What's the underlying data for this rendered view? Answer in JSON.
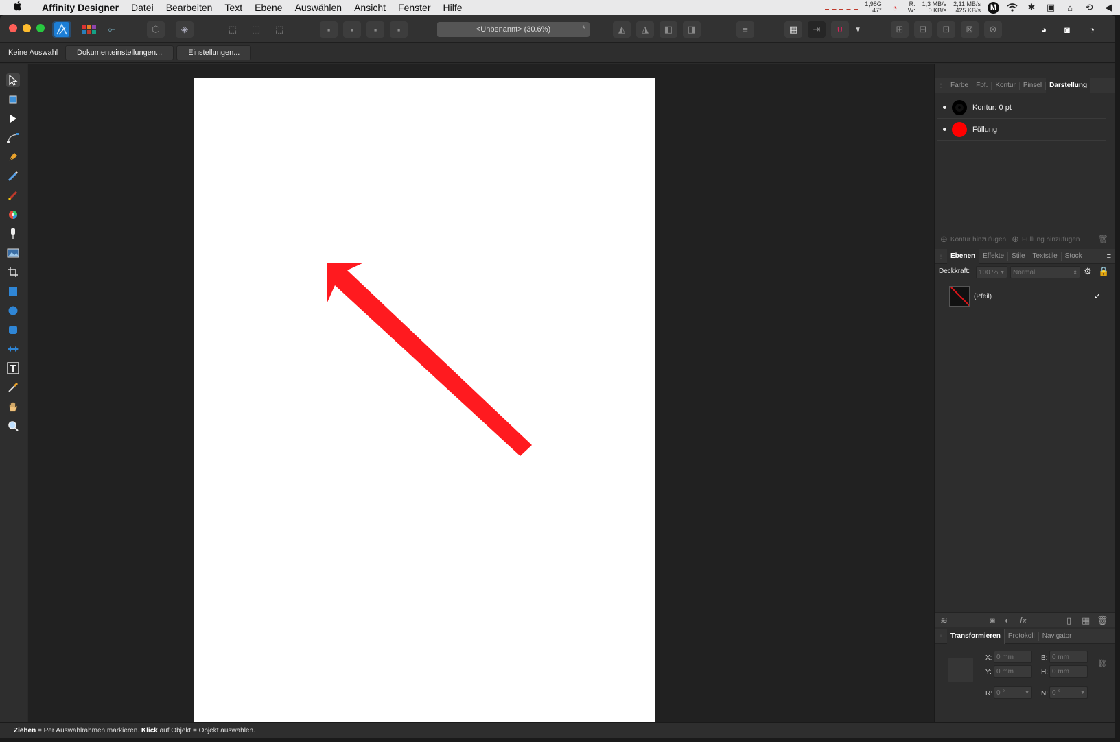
{
  "menubar": {
    "apple_icon": "apple-logo-icon",
    "items": [
      "Affinity Designer",
      "Datei",
      "Bearbeiten",
      "Text",
      "Ebene",
      "Auswählen",
      "Ansicht",
      "Fenster",
      "Hilfe"
    ],
    "status": {
      "mem_top": "1,98G",
      "mem_bottom": "47°",
      "rw_top": "R:",
      "rw_bottom": "W:",
      "net1_top": "1,3 MB/s",
      "net1_bottom": "0 KB/s",
      "net2_top": "2,11 MB/s",
      "net2_bottom": "425 KB/s",
      "m_badge": "M"
    }
  },
  "toolbar": {
    "doc_title": "<Unbenannt> (30.6%)",
    "doc_star": "*"
  },
  "context": {
    "no_selection": "Keine Auswahl",
    "doc_settings": "Dokumenteinstellungen...",
    "preferences": "Einstellungen..."
  },
  "tools": [
    "move-tool-icon",
    "artboard-tool-icon",
    "node-tool-icon",
    "corner-tool-icon",
    "pen-tool-icon",
    "pencil-tool-icon",
    "brush-tool-icon",
    "fill-tool-icon",
    "transparency-tool-icon",
    "place-image-icon",
    "crop-tool-icon",
    "rectangle-tool-icon",
    "ellipse-tool-icon",
    "rounded-rect-tool-icon",
    "contour-tool-icon",
    "text-tool-icon",
    "color-picker-icon",
    "hand-tool-icon",
    "zoom-tool-icon"
  ],
  "appearance": {
    "tabs": [
      "Farbe",
      "Fbf.",
      "Kontur",
      "Pinsel",
      "Darstellung"
    ],
    "stroke_label": "Kontur: 0 pt",
    "fill_label": "Füllung",
    "fill_color": "#ff0000",
    "add_stroke": "Kontur hinzufügen",
    "add_fill": "Füllung hinzufügen"
  },
  "layers": {
    "tabs": [
      "Ebenen",
      "Effekte",
      "Stile",
      "Textstile",
      "Stock"
    ],
    "opacity_label": "Deckkraft:",
    "opacity_value": "100 %",
    "blend_mode": "Normal",
    "layer_name": "(Pfeil)",
    "layer_visible": "✓"
  },
  "transform": {
    "tabs": [
      "Transformieren",
      "Protokoll",
      "Navigator"
    ],
    "x_label": "X:",
    "x_value": "0 mm",
    "y_label": "Y:",
    "y_value": "0 mm",
    "w_label": "B:",
    "w_value": "0 mm",
    "h_label": "H:",
    "h_value": "0 mm",
    "r_label": "R:",
    "r_value": "0 °",
    "n_label": "N:",
    "n_value": "0 °"
  },
  "statusbar": {
    "drag": "Ziehen",
    "drag_text": " = Per Auswahlrahmen markieren. ",
    "click": "Klick",
    "click_text": " auf Objekt = Objekt auswählen."
  },
  "canvas": {
    "arrow_color": "#ff1a1f"
  }
}
